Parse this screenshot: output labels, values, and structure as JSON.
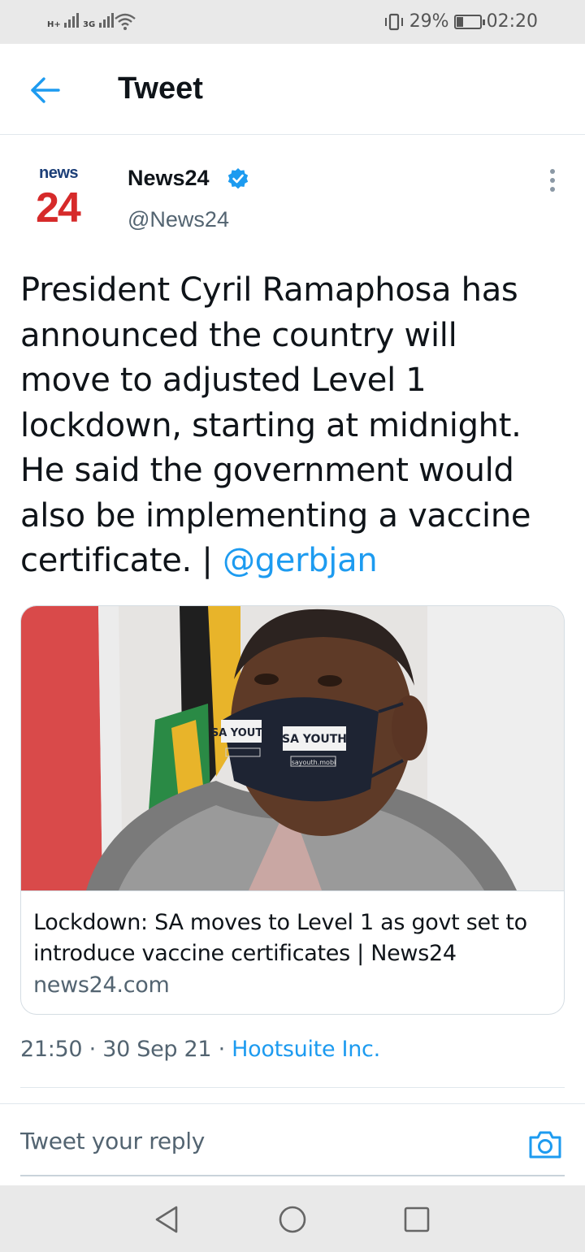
{
  "status_bar": {
    "signal1_label": "H+",
    "signal2_label": "3G",
    "battery_percent": "29%",
    "battery_level": 0.29,
    "time": "02:20",
    "icons": [
      "signal-icon",
      "wifi-icon",
      "vibrate-icon",
      "battery-icon"
    ]
  },
  "header": {
    "title": "Tweet",
    "back_icon": "arrow-left-icon"
  },
  "tweet": {
    "avatar": {
      "line1": "news",
      "line2": "24"
    },
    "author_name": "News24",
    "verified_icon": "verified-badge-icon",
    "handle": "@News24",
    "more_icon": "more-vertical-icon",
    "text": "President Cyril Ramaphosa has announced the country will move to adjusted Level 1 lockdown, starting at midnight. He said the government would also be implementing a vaccine certificate. | ",
    "mention": "@gerbjan",
    "card": {
      "image_mask_text_left": "SA YOUTH",
      "image_mask_text_right": "SA YOUTH",
      "image_mask_url": "sayouth.mobi",
      "title": "Lockdown: SA moves to Level 1 as govt set to introduce vaccine certificates | News24",
      "domain": "news24.com"
    },
    "time": "21:50",
    "separator": "·",
    "date": "30 Sep 21",
    "source": "Hootsuite Inc."
  },
  "reply": {
    "placeholder": "Tweet your reply",
    "camera_icon": "camera-icon"
  },
  "nav_bar": {
    "icons": [
      "back-triangle-icon",
      "home-circle-icon",
      "recents-square-icon"
    ]
  },
  "colors": {
    "accent": "#1d9bf0",
    "text": "#0f1419",
    "muted": "#536471",
    "news24_red": "#d62a2a",
    "news24_blue": "#1d3f78"
  }
}
